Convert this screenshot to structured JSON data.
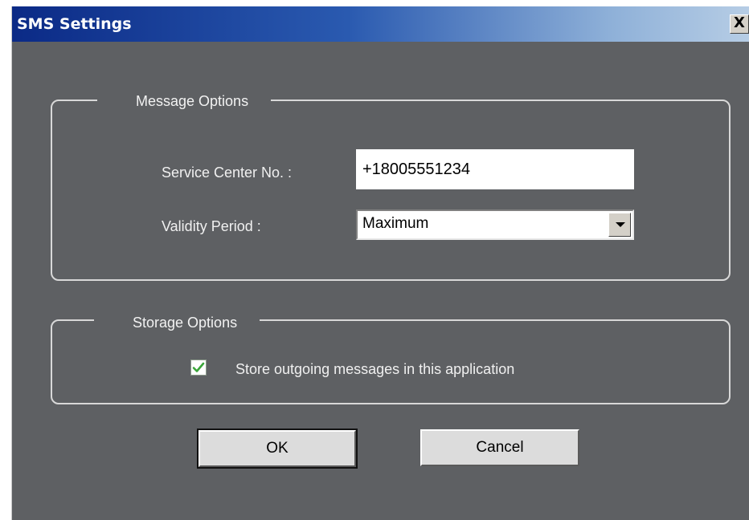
{
  "window": {
    "title": "SMS Settings",
    "close_glyph": "X"
  },
  "message_options": {
    "title": "Message Options",
    "service_center_label": "Service Center No. :",
    "service_center_value": "+18005551234",
    "validity_label": "Validity Period :",
    "validity_value": "Maximum"
  },
  "storage_options": {
    "title": "Storage Options",
    "store_outgoing_label": "Store outgoing messages in this application",
    "store_outgoing_checked": true
  },
  "buttons": {
    "ok_label": "OK",
    "cancel_label": "Cancel"
  },
  "icons": {
    "close": "close-icon",
    "dropdown": "chevron-down-icon",
    "check": "checkmark-icon"
  },
  "colors": {
    "dialog_background": "#5e6063",
    "title_gradient_start": "#0b2a86",
    "title_gradient_end": "#b9cfe6",
    "checkmark": "#3aa63a"
  }
}
